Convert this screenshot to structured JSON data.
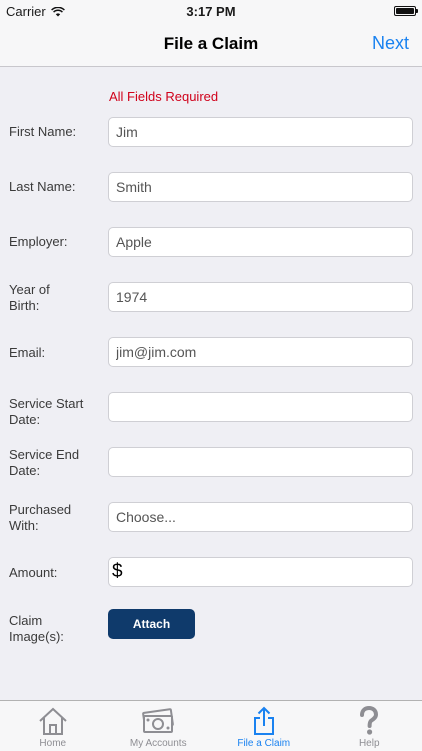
{
  "status_bar": {
    "carrier": "Carrier",
    "time": "3:17 PM"
  },
  "nav": {
    "title": "File a Claim",
    "next_label": "Next"
  },
  "form": {
    "required_note": "All Fields Required",
    "first_name": {
      "label": "First Name:",
      "value": "Jim"
    },
    "last_name": {
      "label": "Last Name:",
      "value": "Smith"
    },
    "employer": {
      "label": "Employer:",
      "value": "Apple"
    },
    "year_of_birth": {
      "label_line1": "Year of",
      "label_line2": "Birth:",
      "value": "1974"
    },
    "email": {
      "label": "Email:",
      "value": "jim@jim.com"
    },
    "service_start": {
      "label_line1": "Service Start",
      "label_line2": "Date:",
      "value": ""
    },
    "service_end": {
      "label_line1": "Service End",
      "label_line2": "Date:",
      "value": ""
    },
    "purchased_with": {
      "label_line1": "Purchased",
      "label_line2": "With:",
      "value": "Choose..."
    },
    "amount": {
      "label": "Amount:",
      "currency": "$",
      "value": ""
    },
    "claim_images": {
      "label_line1": "Claim",
      "label_line2": "Image(s):",
      "button_label": "Attach"
    }
  },
  "tabs": [
    {
      "label": "Home",
      "icon": "home-icon"
    },
    {
      "label": "My Accounts",
      "icon": "money-icon"
    },
    {
      "label": "File a Claim",
      "icon": "share-icon",
      "active": true
    },
    {
      "label": "Help",
      "icon": "help-icon"
    }
  ],
  "colors": {
    "accent": "#1a82f0",
    "required": "#d0021b",
    "button": "#0f3a6b"
  }
}
